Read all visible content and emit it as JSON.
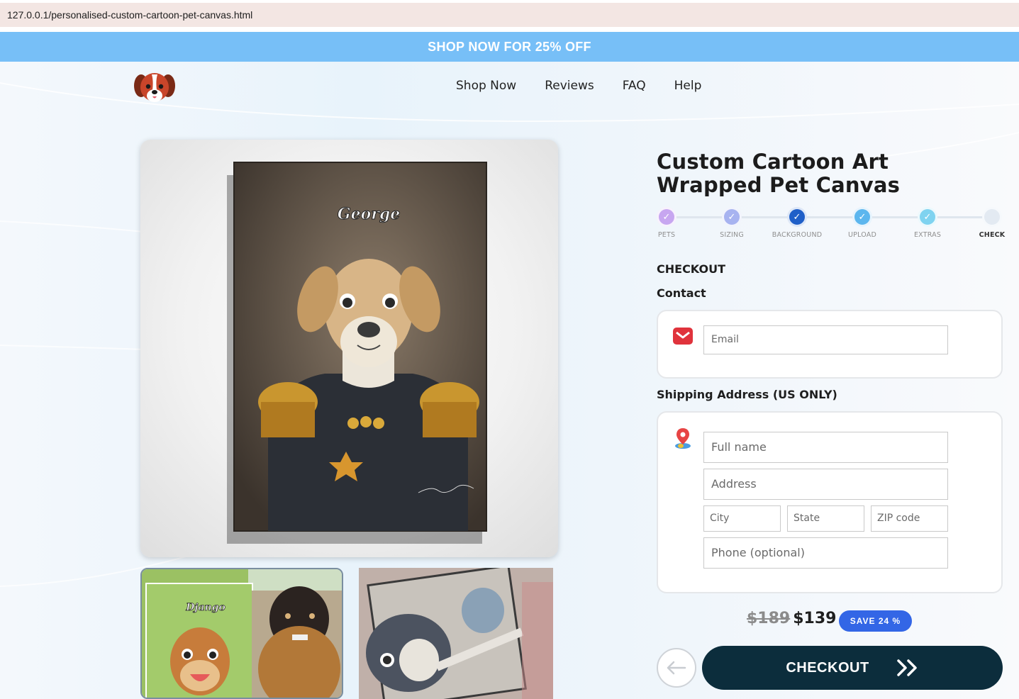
{
  "browser": {
    "url": "127.0.0.1/personalised-custom-cartoon-pet-canvas.html"
  },
  "promo": {
    "text": "SHOP NOW FOR 25% OFF"
  },
  "nav": {
    "items": [
      {
        "label": "Shop Now"
      },
      {
        "label": "Reviews"
      },
      {
        "label": "FAQ"
      },
      {
        "label": "Help"
      }
    ]
  },
  "product": {
    "title": "Custom Cartoon Art Wrapped Pet Canvas",
    "main_image_name_text": "George",
    "thumb1_text": "Django"
  },
  "steps": [
    {
      "label": "PETS",
      "color": "#c7a6f0"
    },
    {
      "label": "SIZING",
      "color": "#a7b3f0"
    },
    {
      "label": "BACKGROUND",
      "color": "#1f5fc8"
    },
    {
      "label": "UPLOAD",
      "color": "#5cb6ee"
    },
    {
      "label": "EXTRAS",
      "color": "#7fd3f0"
    },
    {
      "label": "CHECK",
      "color": "#e3eaf2"
    }
  ],
  "checkout": {
    "heading": "CHECKOUT",
    "contact_heading": "Contact",
    "email_placeholder": "Email",
    "shipping_heading": "Shipping Address (US ONLY)",
    "fullname_placeholder": "Full name",
    "address_placeholder": "Address",
    "city_placeholder": "City",
    "state_placeholder": "State",
    "zip_placeholder": "ZIP code",
    "phone_placeholder": "Phone (optional)"
  },
  "pricing": {
    "old_price": "$189",
    "new_price": "$139",
    "save_badge": "SAVE 24 %"
  },
  "buttons": {
    "checkout_label": "CHECKOUT"
  },
  "colors": {
    "promo_bg": "#77bff7",
    "checkout_btn": "#0c2d3c",
    "save_badge": "#3366e6"
  }
}
